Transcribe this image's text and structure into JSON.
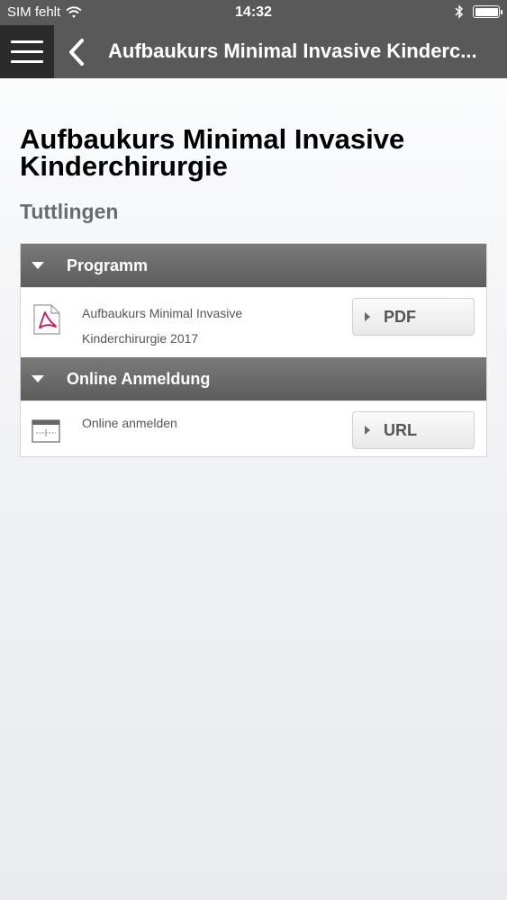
{
  "status_bar": {
    "carrier": "SIM fehlt",
    "time": "14:32",
    "battery_level": 1.0
  },
  "nav": {
    "title": "Aufbaukurs Minimal Invasive Kinderc..."
  },
  "page": {
    "title": "Aufbaukurs Minimal Invasive Kinderchirurgie",
    "subtitle": "Tuttlingen"
  },
  "sections": [
    {
      "header": "Programm",
      "item_text": "Aufbaukurs Minimal Invasive Kinderchirurgie 2017",
      "item_icon": "pdf-document-icon",
      "button_label": "PDF"
    },
    {
      "header": "Online Anmeldung",
      "item_text": "Online anmelden",
      "item_icon": "browser-window-icon",
      "button_label": "URL"
    }
  ],
  "colors": {
    "nav_background": "#595959",
    "menu_background": "#2b2b2b",
    "section_header": "#666666",
    "pdf_accent": "#c2185b"
  }
}
